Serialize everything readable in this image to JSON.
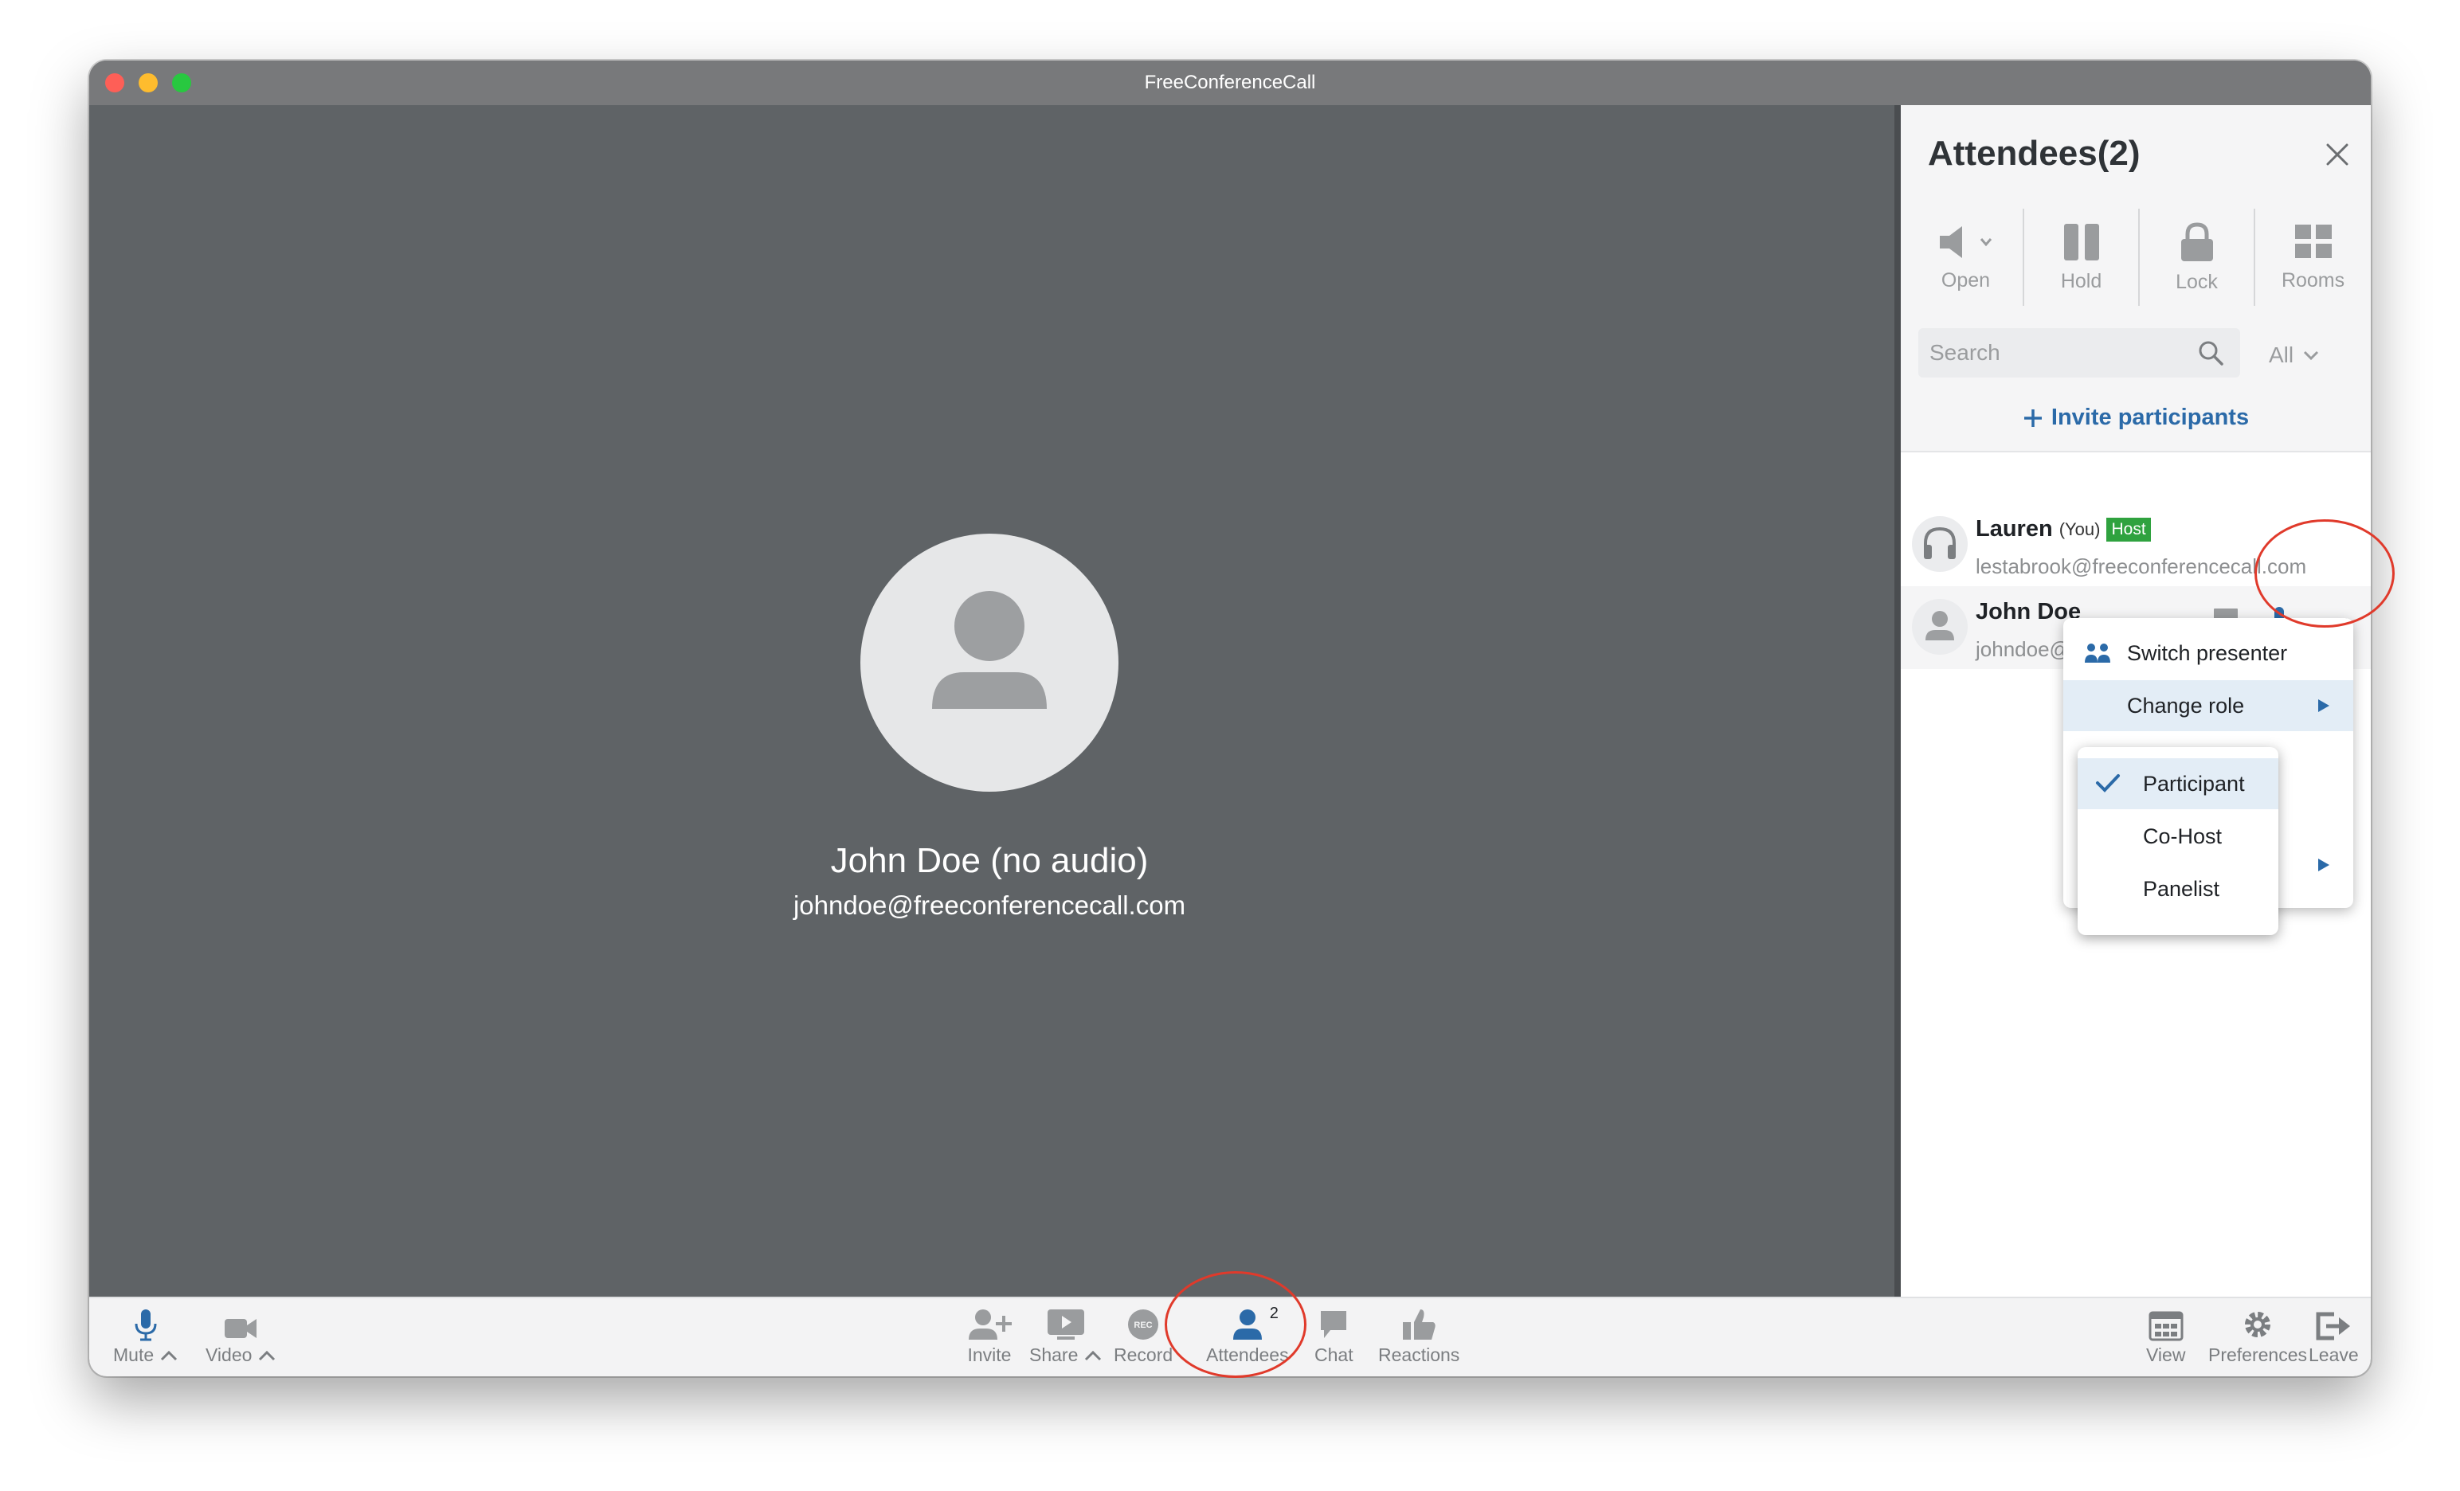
{
  "window": {
    "title": "FreeConferenceCall"
  },
  "stage": {
    "name": "John Doe (no audio)",
    "email": "johndoe@freeconferencecall.com"
  },
  "panel": {
    "title": "Attendees(2)",
    "tools": [
      {
        "label": "Open",
        "icon": "speaker-icon"
      },
      {
        "label": "Hold",
        "icon": "pause-icon"
      },
      {
        "label": "Lock",
        "icon": "lock-icon"
      },
      {
        "label": "Rooms",
        "icon": "grid-icon"
      }
    ],
    "search_placeholder": "Search",
    "filter": "All",
    "invite": "Invite participants",
    "attendees": [
      {
        "name": "Lauren",
        "you": "(You)",
        "badge": "Host",
        "email": "lestabrook@freeconferencecall.com"
      },
      {
        "name": "John Doe",
        "email": "johndoe@freeconfer..."
      }
    ]
  },
  "menu": {
    "items": [
      {
        "label": "Switch presenter"
      },
      {
        "label": "Change role"
      }
    ],
    "roles": [
      {
        "label": "Participant",
        "selected": true
      },
      {
        "label": "Co-Host"
      },
      {
        "label": "Panelist"
      }
    ]
  },
  "toolbar": {
    "mute": "Mute",
    "video": "Video",
    "invite": "Invite",
    "share": "Share",
    "record": "Record",
    "record_badge": "REC",
    "attendees": "Attendees",
    "attendees_count": "2",
    "chat": "Chat",
    "reactions": "Reactions",
    "view": "View",
    "preferences": "Preferences",
    "leave": "Leave"
  },
  "colors": {
    "accent": "#2b6aa8",
    "host_badge": "#2fa23f",
    "annotation": "#e03a2b",
    "stage_bg": "#5f6366"
  }
}
